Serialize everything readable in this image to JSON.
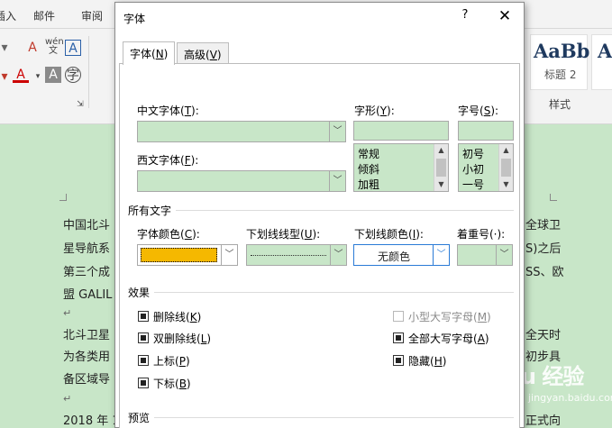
{
  "word": {
    "menu": [
      "插入",
      "邮件",
      "审阅"
    ],
    "ribbon_icons": [
      "clear-format-icon",
      "phonetic-guide-icon",
      "character-border-icon",
      "font-color-icon",
      "character-shading-icon",
      "enclosed-character-icon"
    ],
    "style_samples": [
      {
        "sample": "AaBb(",
        "name": "标题 2"
      },
      {
        "sample": "A",
        "name": ""
      }
    ],
    "styles_group_label": "样式",
    "doc_lines_left": [
      "中国北斗",
      "星导航系",
      "第三个成",
      "盟 GALIL",
      "北斗卫星",
      "为各类用",
      "备区域导",
      "2018 年 1"
    ],
    "doc_lines_right": [
      "全球卫",
      "S)之后",
      "SS、欧",
      "全天时",
      "初步具",
      "",
      "",
      "正式向"
    ],
    "watermark": "Baidu 经验",
    "watermark_sub": "jingyan.baidu.com"
  },
  "dialog": {
    "title": "字体",
    "help": "?",
    "close": "✕",
    "tabs": [
      {
        "label": "字体(",
        "key": "N",
        "suffix": ")"
      },
      {
        "label": "高级(",
        "key": "V",
        "suffix": ")"
      }
    ],
    "chinese_font": {
      "label": "中文字体(",
      "key": "T",
      "suffix": "):",
      "value": ""
    },
    "western_font": {
      "label": "西文字体(",
      "key": "F",
      "suffix": "):",
      "value": ""
    },
    "style": {
      "label": "字形(",
      "key": "Y",
      "suffix": "):",
      "value": "",
      "options": [
        "常规",
        "倾斜",
        "加粗"
      ]
    },
    "size": {
      "label": "字号(",
      "key": "S",
      "suffix": "):",
      "value": "",
      "options": [
        "初号",
        "小初",
        "一号"
      ]
    },
    "all_text_section": "所有文字",
    "font_color": {
      "label": "字体颜色(",
      "key": "C",
      "suffix": "):",
      "color": "#f5b800"
    },
    "underline_style": {
      "label": "下划线线型(",
      "key": "U",
      "suffix": "):"
    },
    "underline_color": {
      "label": "下划线颜色(",
      "key": "I",
      "suffix": "):",
      "value": "无颜色"
    },
    "emphasis": {
      "label": "着重号(·):"
    },
    "effects_section": "效果",
    "effects_left": [
      {
        "label": "删除线(",
        "key": "K",
        "suffix": ")",
        "checked": true
      },
      {
        "label": "双删除线(",
        "key": "L",
        "suffix": ")",
        "checked": true
      },
      {
        "label": "上标(",
        "key": "P",
        "suffix": ")",
        "checked": true
      },
      {
        "label": "下标(",
        "key": "B",
        "suffix": ")",
        "checked": true
      }
    ],
    "effects_right": [
      {
        "label": "小型大写字母(",
        "key": "M",
        "suffix": ")",
        "checked": false,
        "disabled": true
      },
      {
        "label": "全部大写字母(",
        "key": "A",
        "suffix": ")",
        "checked": true,
        "disabled": false
      },
      {
        "label": "隐藏(",
        "key": "H",
        "suffix": ")",
        "checked": true,
        "disabled": false
      }
    ],
    "preview_section": "预览",
    "field_color": "#c8e6c8"
  }
}
